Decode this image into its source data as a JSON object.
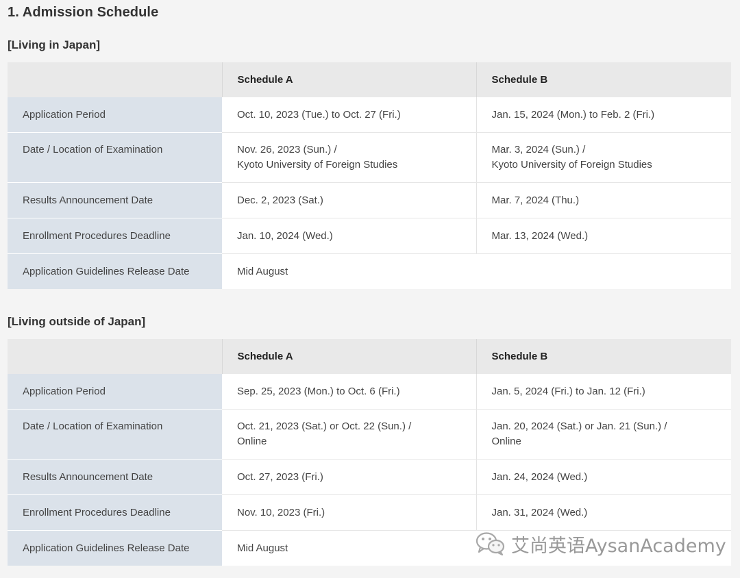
{
  "page_title": "1. Admission Schedule",
  "sections": [
    {
      "heading": "[Living in Japan]",
      "columns": [
        "",
        "Schedule A",
        "Schedule B"
      ],
      "rows": [
        {
          "label": "Application Period",
          "a": [
            "Oct. 10, 2023 (Tue.) to Oct. 27 (Fri.)"
          ],
          "b": [
            "Jan. 15, 2024 (Mon.) to Feb. 2 (Fri.)"
          ]
        },
        {
          "label": "Date / Location of Examination",
          "a": [
            "Nov. 26, 2023 (Sun.) /",
            "Kyoto University of Foreign Studies"
          ],
          "b": [
            "Mar. 3, 2024 (Sun.) /",
            "Kyoto University of Foreign Studies"
          ]
        },
        {
          "label": "Results Announcement Date",
          "a": [
            "Dec. 2, 2023 (Sat.)"
          ],
          "b": [
            "Mar. 7, 2024 (Thu.)"
          ]
        },
        {
          "label": "Enrollment Procedures Deadline",
          "a": [
            "Jan. 10, 2024 (Wed.)"
          ],
          "b": [
            "Mar. 13, 2024 (Wed.)"
          ]
        },
        {
          "label": "Application Guidelines Release Date",
          "a": [
            "Mid August"
          ],
          "b": []
        }
      ]
    },
    {
      "heading": "[Living outside of Japan]",
      "columns": [
        "",
        "Schedule A",
        "Schedule B"
      ],
      "rows": [
        {
          "label": "Application Period",
          "a": [
            "Sep. 25, 2023 (Mon.) to Oct. 6 (Fri.)"
          ],
          "b": [
            "Jan. 5, 2024 (Fri.) to Jan. 12 (Fri.)"
          ]
        },
        {
          "label": "Date / Location of Examination",
          "a": [
            "Oct. 21, 2023 (Sat.) or Oct. 22 (Sun.) /",
            "Online"
          ],
          "b": [
            "Jan. 20, 2024 (Sat.) or Jan. 21 (Sun.) /",
            "Online"
          ]
        },
        {
          "label": "Results Announcement Date",
          "a": [
            "Oct. 27, 2023 (Fri.)"
          ],
          "b": [
            "Jan. 24, 2024 (Wed.)"
          ]
        },
        {
          "label": "Enrollment Procedures Deadline",
          "a": [
            "Nov. 10, 2023 (Fri.)"
          ],
          "b": [
            "Jan. 31, 2024 (Wed.)"
          ]
        },
        {
          "label": "Application Guidelines Release Date",
          "a": [
            "Mid August"
          ],
          "b": []
        }
      ]
    }
  ],
  "watermark": {
    "icon": "wechat-icon",
    "text": "艾尚英语AysanAcademy"
  }
}
